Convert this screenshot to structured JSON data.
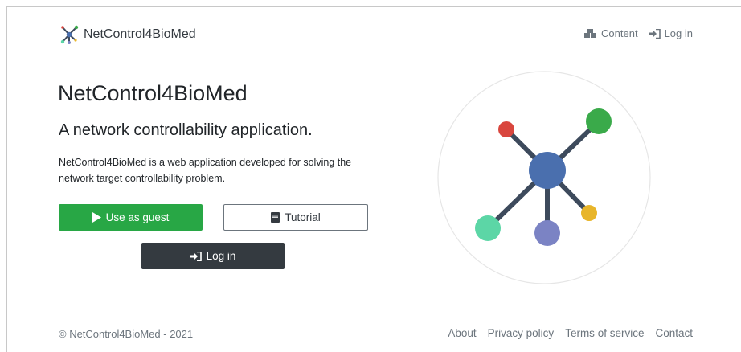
{
  "navbar": {
    "brand": "NetControl4BioMed",
    "links": [
      {
        "label": "Content",
        "icon": "boxes-icon"
      },
      {
        "label": "Log in",
        "icon": "sign-in-icon"
      }
    ]
  },
  "hero": {
    "title": "NetControl4BioMed",
    "subtitle": "A network controllability application.",
    "description": "NetControl4BioMed is a web application developed for solving the network target controllability problem.",
    "buttons": {
      "guest": "Use as guest",
      "tutorial": "Tutorial",
      "login": "Log in"
    }
  },
  "illustration": {
    "colors": {
      "center": "#4a6fae",
      "top_right": "#3aaa4a",
      "top_left": "#d9463e",
      "bottom_left": "#5cd6a6",
      "bottom": "#7b83c4",
      "right": "#e8b52a",
      "edges": "#3d4a5c"
    }
  },
  "footer": {
    "copyright": "© NetControl4BioMed - 2021",
    "links": [
      "About",
      "Privacy policy",
      "Terms of service",
      "Contact"
    ]
  },
  "colors": {
    "success": "#28a745",
    "dark": "#343a40",
    "muted": "#6c757d"
  }
}
